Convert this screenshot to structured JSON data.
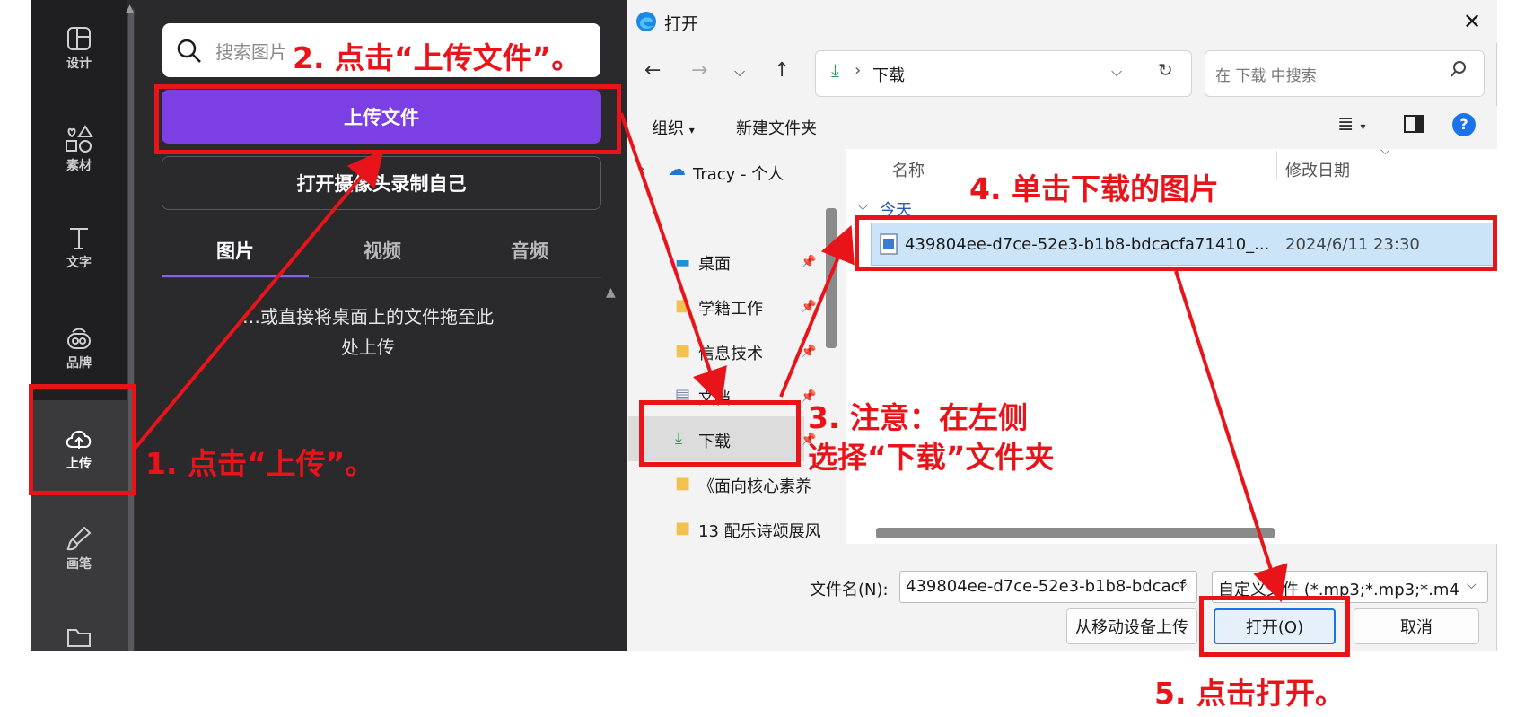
{
  "sidebar": {
    "items": [
      {
        "label": "设计",
        "icon": "layout-icon"
      },
      {
        "label": "素材",
        "icon": "shapes-icon"
      },
      {
        "label": "文字",
        "icon": "text-icon"
      },
      {
        "label": "品牌",
        "icon": "brand-icon"
      },
      {
        "label": "上传",
        "icon": "cloud-upload-icon"
      },
      {
        "label": "画笔",
        "icon": "brush-icon"
      },
      {
        "label": "",
        "icon": "folder-icon"
      }
    ]
  },
  "panel": {
    "search_placeholder": "搜索图片",
    "upload_button": "上传文件",
    "camera_button": "打开摄像头录制自己",
    "tabs": [
      "图片",
      "视频",
      "音频"
    ],
    "drop_hint_line1": "…或直接将桌面上的文件拖至此",
    "drop_hint_line2": "处上传"
  },
  "dialog": {
    "title": "打开",
    "address": "下载",
    "search_placeholder": "在 下载 中搜索",
    "organize": "组织",
    "new_folder": "新建文件夹",
    "help": "?",
    "nav_items": [
      {
        "label": "Tracy - 个人"
      },
      {
        "label": "桌面"
      },
      {
        "label": "学籍工作"
      },
      {
        "label": "信息技术"
      },
      {
        "label": "文档"
      },
      {
        "label": "下载"
      },
      {
        "label": "《面向核心素养"
      },
      {
        "label": "13 配乐诗颂展风"
      }
    ],
    "columns": {
      "name": "名称",
      "date": "修改日期"
    },
    "group": "今天",
    "file": {
      "name": "439804ee-d7ce-52e3-b1b8-bdcacfa71410_...",
      "date": "2024/6/11 23:30"
    },
    "filename_label": "文件名(N):",
    "filename_value": "439804ee-d7ce-52e3-b1b8-bdcacf",
    "filetype_value": "自定义文件 (*.mp3;*.mp3;*.m4",
    "btn_mobile": "从移动设备上传",
    "btn_open": "打开(O)",
    "btn_cancel": "取消"
  },
  "annotations": {
    "step1": "1. 点击“上传”。",
    "step2": "2. 点击“上传文件”。",
    "step3_line1": "3. 注意：在左侧",
    "step3_line2": "选择“下载”文件夹",
    "step4": "4. 单击下载的图片",
    "step5": "5. 点击打开。"
  },
  "colors": {
    "accent_purple": "#7b3fe4",
    "annotation_red": "#e8141a",
    "selection_blue": "#cce4f7"
  }
}
